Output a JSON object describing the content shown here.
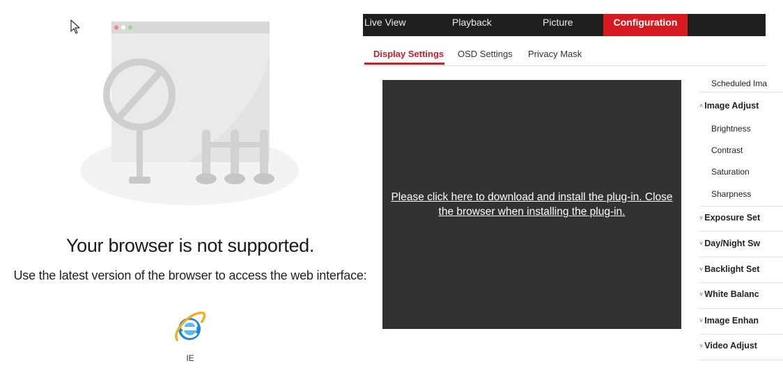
{
  "left": {
    "title": "Your browser is not supported.",
    "subtitle": "Use the latest version of the browser to access the web interface:",
    "browsers": [
      {
        "name": "IE",
        "icon": "internet-explorer-icon"
      }
    ]
  },
  "top_nav": [
    {
      "label": "Live View",
      "active": false
    },
    {
      "label": "Playback",
      "active": false
    },
    {
      "label": "Picture",
      "active": false
    },
    {
      "label": "Configuration",
      "active": true
    }
  ],
  "sub_tabs": [
    {
      "label": "Display Settings",
      "active": true
    },
    {
      "label": "OSD Settings",
      "active": false
    },
    {
      "label": "Privacy Mask",
      "active": false
    }
  ],
  "video": {
    "plugin_message_line1": "Please click here to download and install the plug-in. Close",
    "plugin_message_line2": "the browser when installing the plug-in."
  },
  "side_menu": {
    "scheduled": "Scheduled Ima",
    "image_adjust": "Image Adjust",
    "brightness": "Brightness",
    "contrast": "Contrast",
    "saturation": "Saturation",
    "sharpness": "Sharpness",
    "exposure": "Exposure Set",
    "daynight": "Day/Night Sw",
    "backlight": "Backlight Set",
    "whitebalance": "White Balanc",
    "enhancement": "Image Enhan",
    "video_adjust": "Video Adjust"
  },
  "colors": {
    "accent": "#d71920",
    "topbar": "#1f1f1f",
    "video_bg": "#323232"
  }
}
